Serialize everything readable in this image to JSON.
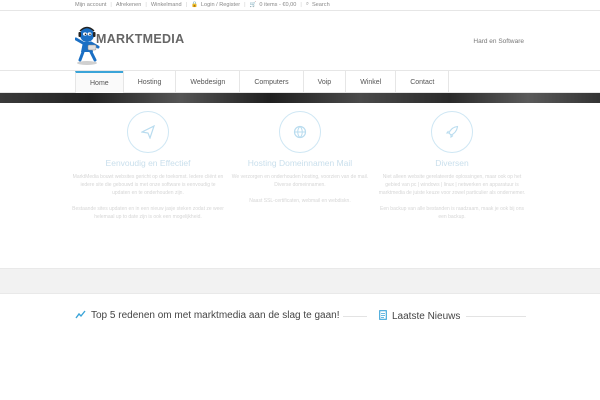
{
  "topbar": {
    "my_account": "Mijn account",
    "checkout": "Afrekenen",
    "cart": "Winkelmand",
    "login": "Login / Register",
    "cart_summary": "0 items - €0,00",
    "search": "Search"
  },
  "header": {
    "logo_text": "MARKTMEDIA",
    "tagline": "Hard en Software"
  },
  "nav": [
    "Home",
    "Hosting",
    "Webdesign",
    "Computers",
    "Voip",
    "Winkel",
    "Contact"
  ],
  "features": [
    {
      "icon": "paper-plane-icon",
      "title": "Eenvoudig en Effectief",
      "text": [
        "MarktMedia bouwt websites gericht op de toekomst. Iedere cliënt en iedere site die gebouwd is met onze software is eenvoudig te updaten en te onderhouden zijn.",
        "Bestaande sites updaten en in een nieuw jasje steken zodat ze weer helemaal up to date zijn is ook een mogelijkheid."
      ]
    },
    {
      "icon": "globe-icon",
      "title": "Hosting Domeinnamen Mail",
      "text": [
        "We verzorgen en onderhouden hosting, voorzien van de mail. Diverse domeinnamen.",
        "Naast SSL-certificaten, webmail en webdiskn."
      ]
    },
    {
      "icon": "rocket-icon",
      "title": "Diversen",
      "text": [
        "Niet alleen website gerelateerde oplossingen, maar ook op het gebied van pc | windows | linux | netwerken en apparatuur is marktmedia de juiste keuze voor zowel particulier als ondernemer.",
        "Een backup van alle bestanden is raadzaam, maak je ook bij ons een backup."
      ]
    }
  ],
  "sections": {
    "top5": "Top 5 redenen om met marktmedia aan de slag te gaan!",
    "news": "Laatste Nieuws"
  },
  "colors": {
    "accent": "#3aa4d8"
  }
}
